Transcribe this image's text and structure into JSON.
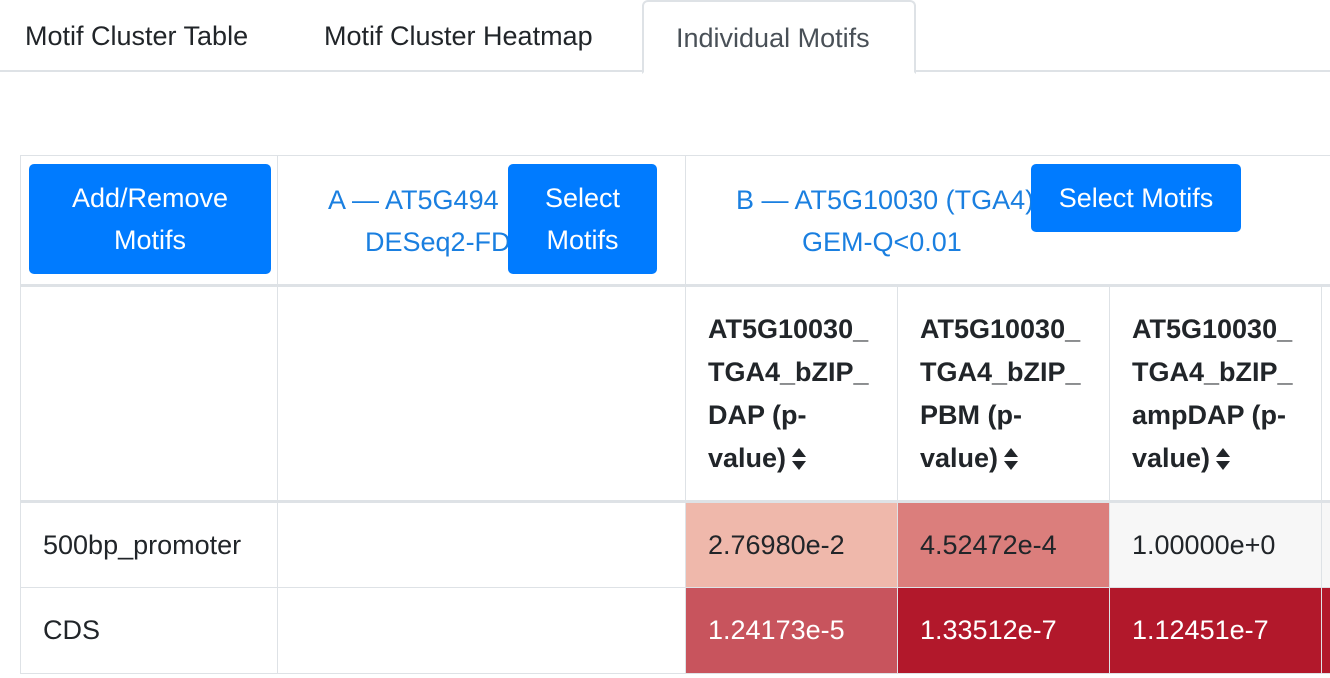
{
  "tabs": [
    {
      "label": "Motif Cluster Table"
    },
    {
      "label": "Motif Cluster Heatmap"
    },
    {
      "label": "Individual Motifs"
    }
  ],
  "controls": {
    "add_remove_label_1": "Add/Remove",
    "add_remove_label_2": "Motifs",
    "group_a_line1": "A — AT5G494",
    "group_a_line2": "DESeq2-FD",
    "group_a_button_1": "Select",
    "group_a_button_2": "Motifs",
    "group_b_line1": "B — AT5G10030 (TGA4)",
    "group_b_line2": "GEM-Q<0.01",
    "group_b_button": "Select Motifs"
  },
  "columns": [
    {
      "lines": [
        "AT5G10030_",
        "TGA4_bZIP_",
        "DAP (p-",
        "value)"
      ]
    },
    {
      "lines": [
        "AT5G10030_",
        "TGA4_bZIP_",
        "PBM (p-",
        "value)"
      ]
    },
    {
      "lines": [
        "AT5G10030_",
        "TGA4_bZIP_",
        "ampDAP (p-",
        "value)"
      ]
    }
  ],
  "rows": [
    {
      "label": "500bp_promoter",
      "values": [
        "2.76980e-2",
        "4.52472e-4",
        "1.00000e+0"
      ]
    },
    {
      "label": "CDS",
      "values": [
        "1.24173e-5",
        "1.33512e-7",
        "1.12451e-7"
      ]
    }
  ],
  "colors": {
    "button": "#007bff",
    "link": "#1a7fe0",
    "heat": [
      [
        "#efb8ab",
        "#db7e7c",
        "#f7f7f7"
      ],
      [
        "#c8545d",
        "#b2182b",
        "#b2182b"
      ]
    ],
    "heat_text": [
      [
        "#212529",
        "#212529",
        "#212529"
      ],
      [
        "#ffffff",
        "#ffffff",
        "#ffffff"
      ]
    ]
  }
}
